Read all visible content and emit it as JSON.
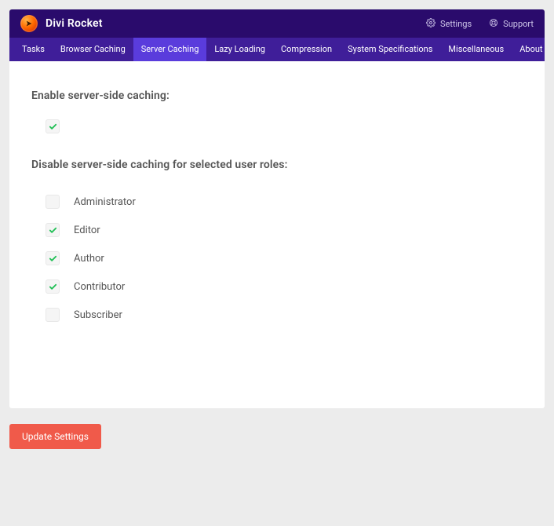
{
  "brand": {
    "title": "Divi Rocket"
  },
  "headerActions": {
    "settings": {
      "label": "Settings"
    },
    "support": {
      "label": "Support"
    }
  },
  "tabs": [
    {
      "label": "Tasks",
      "active": false
    },
    {
      "label": "Browser Caching",
      "active": false
    },
    {
      "label": "Server Caching",
      "active": true
    },
    {
      "label": "Lazy Loading",
      "active": false
    },
    {
      "label": "Compression",
      "active": false
    },
    {
      "label": "System Specifications",
      "active": false
    },
    {
      "label": "Miscellaneous",
      "active": false
    },
    {
      "label": "About & License Key",
      "active": false
    }
  ],
  "sections": {
    "enable": {
      "heading": "Enable server-side caching:",
      "checkbox": {
        "checked": true
      }
    },
    "disableRoles": {
      "heading": "Disable server-side caching for selected user roles:",
      "items": [
        {
          "label": "Administrator",
          "checked": false
        },
        {
          "label": "Editor",
          "checked": true
        },
        {
          "label": "Author",
          "checked": true
        },
        {
          "label": "Contributor",
          "checked": true
        },
        {
          "label": "Subscriber",
          "checked": false
        }
      ]
    }
  },
  "footer": {
    "updateLabel": "Update Settings"
  },
  "colors": {
    "accent": "#5a3cdc",
    "checkboxCheck": "#20bf55",
    "danger": "#f05a4a"
  }
}
